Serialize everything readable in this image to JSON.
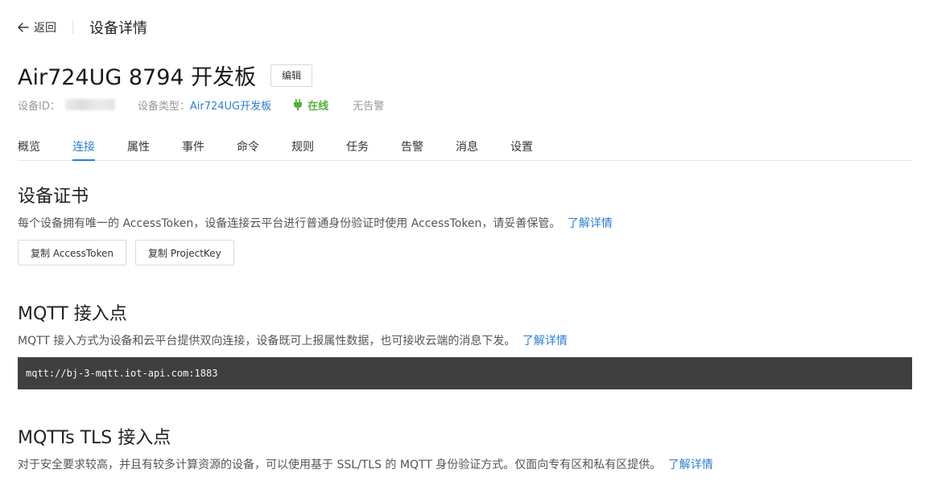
{
  "header": {
    "back_label": "返回",
    "page_title": "设备详情"
  },
  "device": {
    "name": "Air724UG 8794 开发板",
    "edit_label": "编辑",
    "id_label": "设备ID：",
    "type_label": "设备类型：",
    "type_value": "Air724UG开发板",
    "status": "在线",
    "status_color": "#52b23a",
    "alarm_status": "无告警"
  },
  "tabs": [
    {
      "label": "概览"
    },
    {
      "label": "连接"
    },
    {
      "label": "属性"
    },
    {
      "label": "事件"
    },
    {
      "label": "命令"
    },
    {
      "label": "规则"
    },
    {
      "label": "任务"
    },
    {
      "label": "告警"
    },
    {
      "label": "消息"
    },
    {
      "label": "设置"
    }
  ],
  "active_tab": "连接",
  "cert": {
    "title": "设备证书",
    "desc": "每个设备拥有唯一的 AccessToken，设备连接云平台进行普通身份验证时使用 AccessToken，请妥善保管。",
    "learn_more": "了解详情",
    "copy_token_label": "复制 AccessToken",
    "copy_key_label": "复制 ProjectKey"
  },
  "mqtt": {
    "title": "MQTT 接入点",
    "desc": "MQTT 接入方式为设备和云平台提供双向连接，设备既可上报属性数据，也可接收云端的消息下发。",
    "learn_more": "了解详情",
    "endpoint": "mqtt://bj-3-mqtt.iot-api.com:1883"
  },
  "mqtts": {
    "title": "MQTTs TLS 接入点",
    "desc": "对于安全要求较高，并且有较多计算资源的设备，可以使用基于 SSL/TLS 的 MQTT 身份验证方式。仅面向专有区和私有区提供。",
    "learn_more": "了解详情"
  },
  "colors": {
    "accent": "#2b7fd6",
    "online": "#52b23a",
    "code_bg": "#3f3f3f"
  }
}
